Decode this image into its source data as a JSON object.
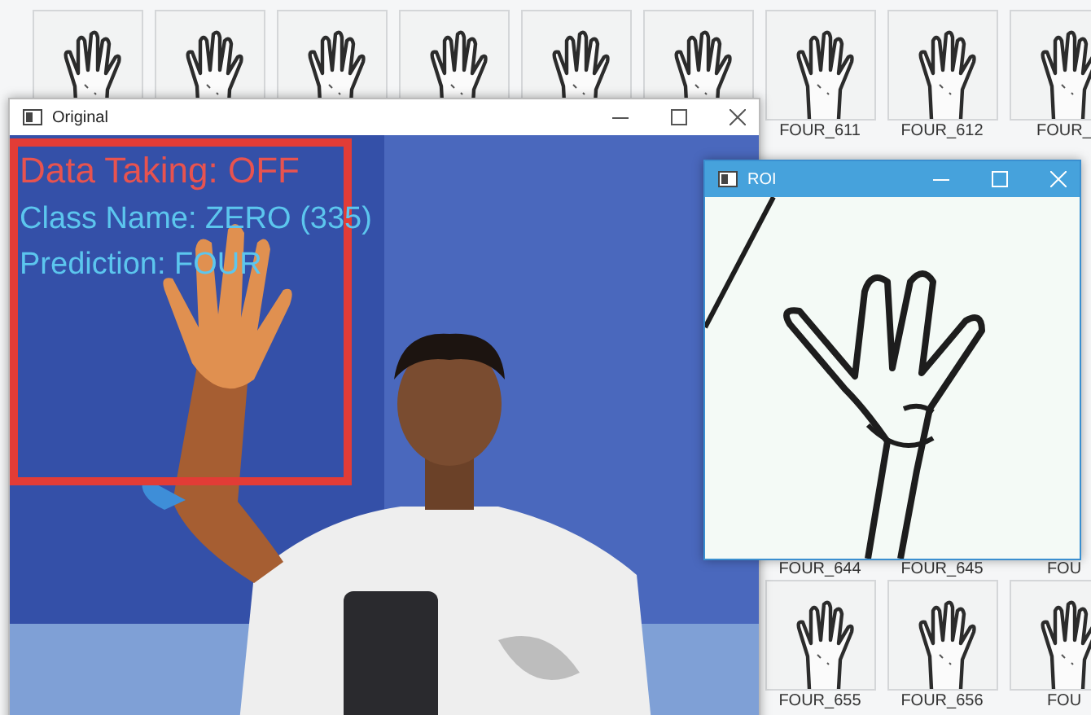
{
  "desktop": {
    "thumbnail_rows": [
      {
        "tiles": [
          {
            "kind": "thumbnail"
          },
          {
            "kind": "thumbnail"
          },
          {
            "kind": "thumbnail"
          },
          {
            "kind": "thumbnail"
          },
          {
            "kind": "thumbnail"
          },
          {
            "kind": "thumbnail"
          },
          {
            "kind": "thumbnail",
            "label": "FOUR_611"
          },
          {
            "kind": "thumbnail",
            "label": "FOUR_612"
          },
          {
            "kind": "thumbnail",
            "label": "FOUR_"
          }
        ]
      },
      {
        "tiles": [
          {
            "kind": "label_only",
            "label": "FOUR_644"
          },
          {
            "kind": "label_only",
            "label": "FOUR_645"
          },
          {
            "kind": "label_only",
            "label": "FOU"
          }
        ]
      },
      {
        "tiles": [
          {
            "kind": "thumbnail",
            "label": "FOUR_655"
          },
          {
            "kind": "thumbnail",
            "label": "FOUR_656"
          },
          {
            "kind": "thumbnail",
            "label": "FOU"
          }
        ]
      }
    ]
  },
  "windows": [
    {
      "kind": "camera",
      "title": "Original",
      "active": false,
      "overlay_lines": [
        {
          "text": "Data Taking: OFF",
          "color": "#e8534f"
        },
        {
          "text": "Class Name: ZERO (335)",
          "color": "#5cc6ee"
        },
        {
          "text": "Prediction: FOUR",
          "color": "#5cc6ee"
        }
      ]
    },
    {
      "kind": "roi",
      "title": "ROI",
      "active": true
    }
  ]
}
